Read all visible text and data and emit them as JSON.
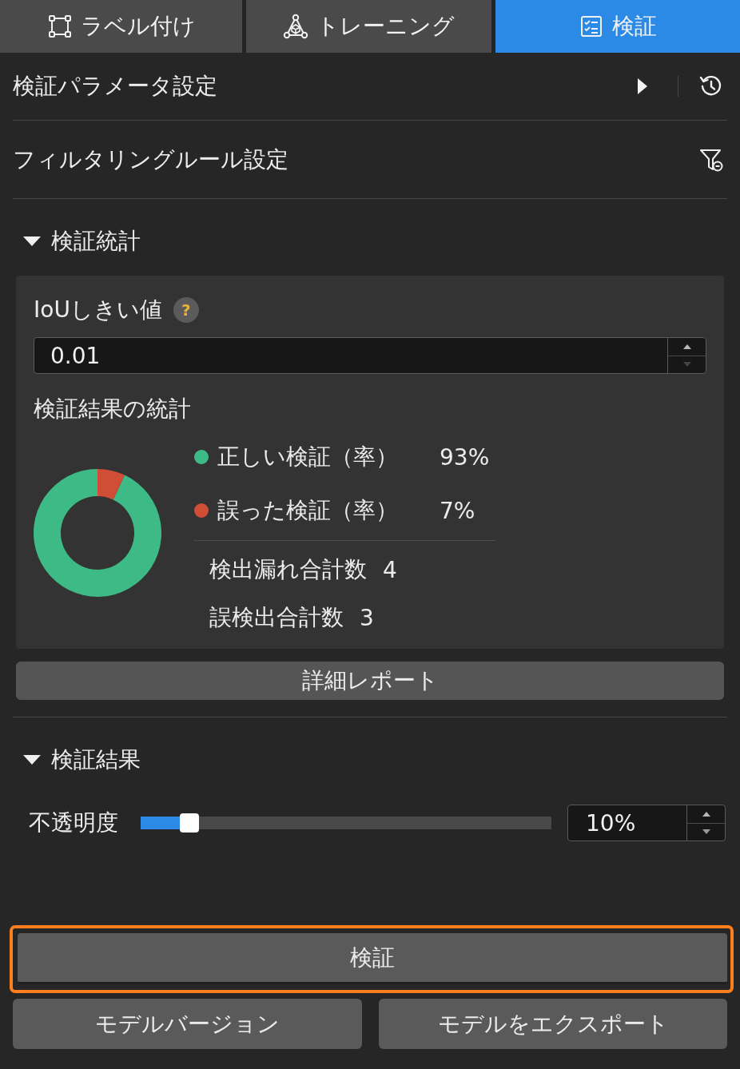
{
  "tabs": [
    {
      "kind": "label",
      "label": "ラベル付け",
      "selected": false
    },
    {
      "kind": "training",
      "label": "トレーニング",
      "selected": false
    },
    {
      "kind": "verify",
      "label": "検証",
      "selected": true
    }
  ],
  "settings_rows": [
    {
      "kind": "parameters",
      "label": "検証パラメータ設定"
    },
    {
      "kind": "filter",
      "label": "フィルタリングルール設定"
    }
  ],
  "statistics": {
    "title": "検証統計",
    "expanded": true,
    "iou": {
      "label": "IoUしきい値",
      "help": "?",
      "value": "0.01",
      "decrement_disabled": true
    },
    "stats_title": "検証結果の統計",
    "chart_data": {
      "type": "donut",
      "values": [
        93,
        7
      ]
    },
    "legend": [
      {
        "label": "正しい検証（率）",
        "value": "93%",
        "color": "#3dba86"
      },
      {
        "label": "誤った検証（率）",
        "value": "7%",
        "color": "#cf4e35"
      }
    ],
    "totals": [
      {
        "label": "検出漏れ合計数",
        "value": "4"
      },
      {
        "label": "誤検出合計数",
        "value": "3"
      }
    ],
    "report_button": "詳細レポート"
  },
  "results": {
    "title": "検証結果",
    "expanded": true,
    "opacity": {
      "label": "不透明度",
      "level": 0.1,
      "value": "10%",
      "decrement_disabled": false
    }
  },
  "actions": {
    "verify": {
      "label": "検証",
      "highlighted": true
    },
    "buttons": [
      "モデルバージョン",
      "モデルをエクスポート"
    ]
  }
}
